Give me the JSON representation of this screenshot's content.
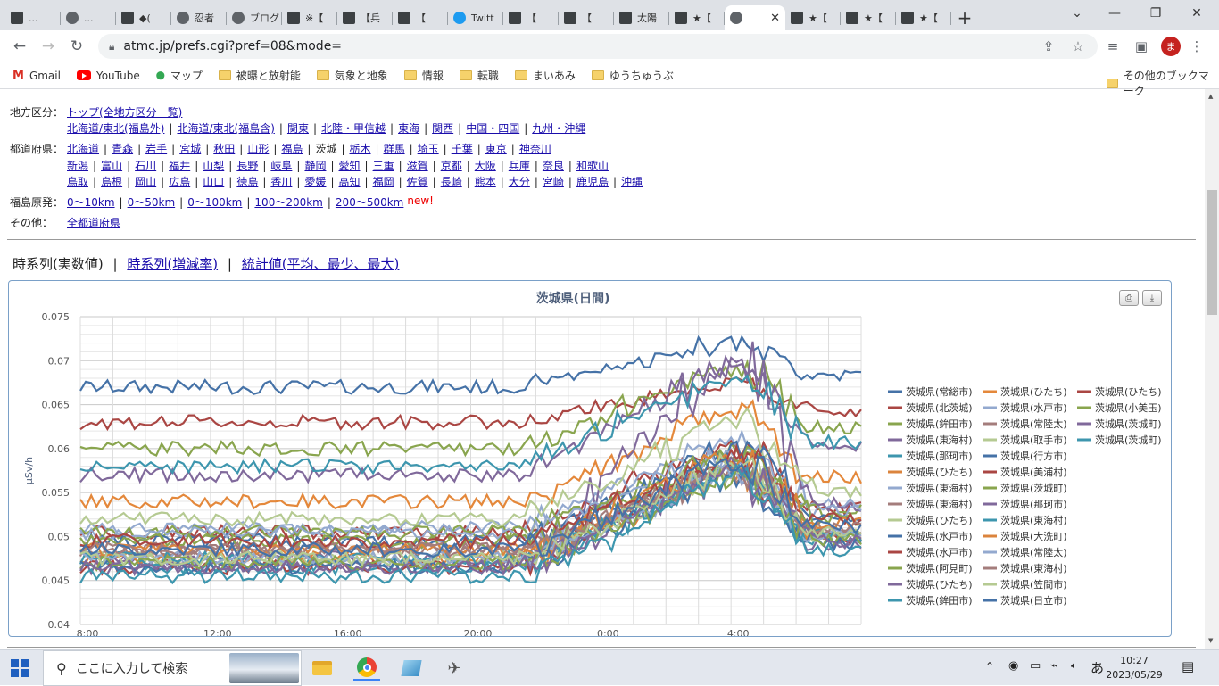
{
  "browser": {
    "tabs": [
      {
        "label": "...",
        "icon": "site-icon"
      },
      {
        "label": "...",
        "icon": "globe-icon"
      },
      {
        "label": "◆(",
        "icon": "site-icon"
      },
      {
        "label": "忍者",
        "icon": "globe-icon"
      },
      {
        "label": "ブログ",
        "icon": "globe-icon"
      },
      {
        "label": "※【",
        "icon": "site-icon"
      },
      {
        "label": "【兵",
        "icon": "site-icon"
      },
      {
        "label": "【 ",
        "icon": "site-icon"
      },
      {
        "label": "Twitt",
        "icon": "twitter-icon"
      },
      {
        "label": "【 ",
        "icon": "site-icon"
      },
      {
        "label": "【 ",
        "icon": "site-icon"
      },
      {
        "label": "太陽",
        "icon": "site-icon"
      },
      {
        "label": "★【",
        "icon": "site-icon"
      },
      {
        "label": "",
        "icon": "globe-icon",
        "active": true
      },
      {
        "label": "★【",
        "icon": "site-icon"
      },
      {
        "label": "★【",
        "icon": "site-icon"
      },
      {
        "label": "★【",
        "icon": "site-icon"
      }
    ],
    "new_tab": "+",
    "url": "atmc.jp/prefs.cgi?pref=08&mode=",
    "profile_initial": "ま",
    "bookmarks": [
      {
        "label": "Gmail",
        "icon": "gmail-icon"
      },
      {
        "label": "YouTube",
        "icon": "youtube-icon"
      },
      {
        "label": "マップ",
        "icon": "maps-icon"
      },
      {
        "label": "被曝と放射能",
        "icon": "folder-icon"
      },
      {
        "label": "気象と地象",
        "icon": "folder-icon"
      },
      {
        "label": "情報",
        "icon": "folder-icon"
      },
      {
        "label": "転職",
        "icon": "folder-icon"
      },
      {
        "label": "まいあみ",
        "icon": "folder-icon"
      },
      {
        "label": "ゆうちゅうぶ",
        "icon": "folder-icon"
      }
    ],
    "other_bookmarks": "その他のブックマーク"
  },
  "nav": {
    "region_label": "地方区分：",
    "region_row1": [
      "トップ(全地方区分一覧)"
    ],
    "region_row2": [
      "北海道/東北(福島外)",
      "北海道/東北(福島含)",
      "関東",
      "北陸・甲信越",
      "東海",
      "関西",
      "中国・四国",
      "九州・沖縄"
    ],
    "pref_label": "都道府県：",
    "pref_row1": [
      "北海道",
      "青森",
      "岩手",
      "宮城",
      "秋田",
      "山形",
      "福島",
      "茨城",
      "栃木",
      "群馬",
      "埼玉",
      "千葉",
      "東京",
      "神奈川"
    ],
    "pref_row2": [
      "新潟",
      "富山",
      "石川",
      "福井",
      "山梨",
      "長野",
      "岐阜",
      "静岡",
      "愛知",
      "三重",
      "滋賀",
      "京都",
      "大阪",
      "兵庫",
      "奈良",
      "和歌山"
    ],
    "pref_row3": [
      "鳥取",
      "島根",
      "岡山",
      "広島",
      "山口",
      "徳島",
      "香川",
      "愛媛",
      "高知",
      "福岡",
      "佐賀",
      "長崎",
      "熊本",
      "大分",
      "宮崎",
      "鹿児島",
      "沖縄"
    ],
    "current_pref": "茨城",
    "fukushima_label": "福島原発：",
    "fukushima_links": [
      "0～10km",
      "0～50km",
      "0～100km",
      "100～200km",
      "200～500km"
    ],
    "new_badge": "new!",
    "other_label": "その他：",
    "other_links": [
      "全都道府県"
    ]
  },
  "modes": {
    "current": "時系列(実数値)",
    "links": [
      "時系列(増減率)",
      "統計値(平均、最少、最大)"
    ],
    "separator": "|"
  },
  "chart_data": {
    "type": "line",
    "title": "茨城県(日間)",
    "ylabel": "μSv/h",
    "xlabel": "",
    "ylim": [
      0.04,
      0.075
    ],
    "yticks": [
      "0.075",
      "0.07",
      "0.065",
      "0.06",
      "0.055",
      "0.05",
      "0.045",
      "0.04"
    ],
    "xticks": [
      "8:00",
      "12:00",
      "16:00",
      "20:00",
      "0:00",
      "4:00"
    ],
    "x_hours": {
      "start": "8:00",
      "end": "≈8:00 next day"
    },
    "grid": true,
    "legend_position": "right",
    "series": [
      {
        "name": "茨城県(常総市)",
        "color": "#4572a7",
        "base": 0.067,
        "peak": 0.0725
      },
      {
        "name": "茨城県(ひたち)",
        "color": "#e4883b",
        "base": 0.054,
        "peak": 0.065
      },
      {
        "name": "茨城県(ひたち)",
        "color": "#aa4643",
        "base": 0.063,
        "peak": 0.068
      },
      {
        "name": "茨城県(北茨城)",
        "color": "#aa4643",
        "base": 0.0505,
        "peak": 0.061
      },
      {
        "name": "茨城県(水戸市)",
        "color": "#93a9cf",
        "base": 0.051,
        "peak": 0.062
      },
      {
        "name": "茨城県(小美玉)",
        "color": "#89a54e",
        "base": 0.0505,
        "peak": 0.06
      },
      {
        "name": "茨城県(鉾田市)",
        "color": "#89a54e",
        "base": 0.06,
        "peak": 0.07
      },
      {
        "name": "茨城県(常陸太)",
        "color": "#a47d7c",
        "base": 0.0485,
        "peak": 0.058
      },
      {
        "name": "茨城県(茨城町)",
        "color": "#80699b",
        "base": 0.057,
        "peak": 0.0705
      },
      {
        "name": "茨城県(東海村)",
        "color": "#80699b",
        "base": 0.0475,
        "peak": 0.072
      },
      {
        "name": "茨城県(取手市)",
        "color": "#b5ca92",
        "base": 0.052,
        "peak": 0.064
      },
      {
        "name": "茨城県(茨城町)",
        "color": "#3d96ae",
        "base": 0.058,
        "peak": 0.069
      },
      {
        "name": "茨城県(那珂市)",
        "color": "#3d96ae",
        "base": 0.0465,
        "peak": 0.059
      },
      {
        "name": "茨城県(行方市)",
        "color": "#4572a7",
        "base": 0.0495,
        "peak": 0.061
      },
      {
        "name": "茨城県(ひたち)",
        "color": "#db843d",
        "base": 0.0475,
        "peak": 0.058
      },
      {
        "name": "茨城県(美浦村)",
        "color": "#aa4643",
        "base": 0.0465,
        "peak": 0.06
      },
      {
        "name": "茨城県(東海村)",
        "color": "#93a9cf",
        "base": 0.0505,
        "peak": 0.06
      },
      {
        "name": "茨城県(茨城町)",
        "color": "#89a54e",
        "base": 0.0495,
        "peak": 0.0595
      },
      {
        "name": "茨城県(東海村)",
        "color": "#a47d7c",
        "base": 0.0485,
        "peak": 0.058
      },
      {
        "name": "茨城県(那珂市)",
        "color": "#80699b",
        "base": 0.0465,
        "peak": 0.0575
      },
      {
        "name": "茨城県(ひたち)",
        "color": "#b5ca92",
        "base": 0.0475,
        "peak": 0.0585
      },
      {
        "name": "茨城県(東海村)",
        "color": "#3d96ae",
        "base": 0.0475,
        "peak": 0.058
      },
      {
        "name": "茨城県(水戸市)",
        "color": "#4572a7",
        "base": 0.0465,
        "peak": 0.0575
      },
      {
        "name": "茨城県(大洗町)",
        "color": "#db843d",
        "base": 0.0485,
        "peak": 0.06
      },
      {
        "name": "茨城県(水戸市)",
        "color": "#aa4643",
        "base": 0.0495,
        "peak": 0.0595
      },
      {
        "name": "茨城県(常陸太)",
        "color": "#93a9cf",
        "base": 0.0475,
        "peak": 0.058
      },
      {
        "name": "茨城県(阿見町)",
        "color": "#89a54e",
        "base": 0.047,
        "peak": 0.0575
      },
      {
        "name": "茨城県(東海村)",
        "color": "#a47d7c",
        "base": 0.0485,
        "peak": 0.0585
      },
      {
        "name": "茨城県(ひたち)",
        "color": "#80699b",
        "base": 0.0465,
        "peak": 0.0585
      },
      {
        "name": "茨城県(笠間市)",
        "color": "#b5ca92",
        "base": 0.0475,
        "peak": 0.059
      },
      {
        "name": "茨城県(鉾田市)",
        "color": "#3d96ae",
        "base": 0.0455,
        "peak": 0.0575
      },
      {
        "name": "茨城県(日立市)",
        "color": "#4572a7",
        "base": 0.0485,
        "peak": 0.059
      }
    ]
  },
  "taskbar": {
    "search_placeholder": "ここに入力して検索",
    "time": "10:27",
    "date": "2023/05/29",
    "ime": "あ"
  }
}
